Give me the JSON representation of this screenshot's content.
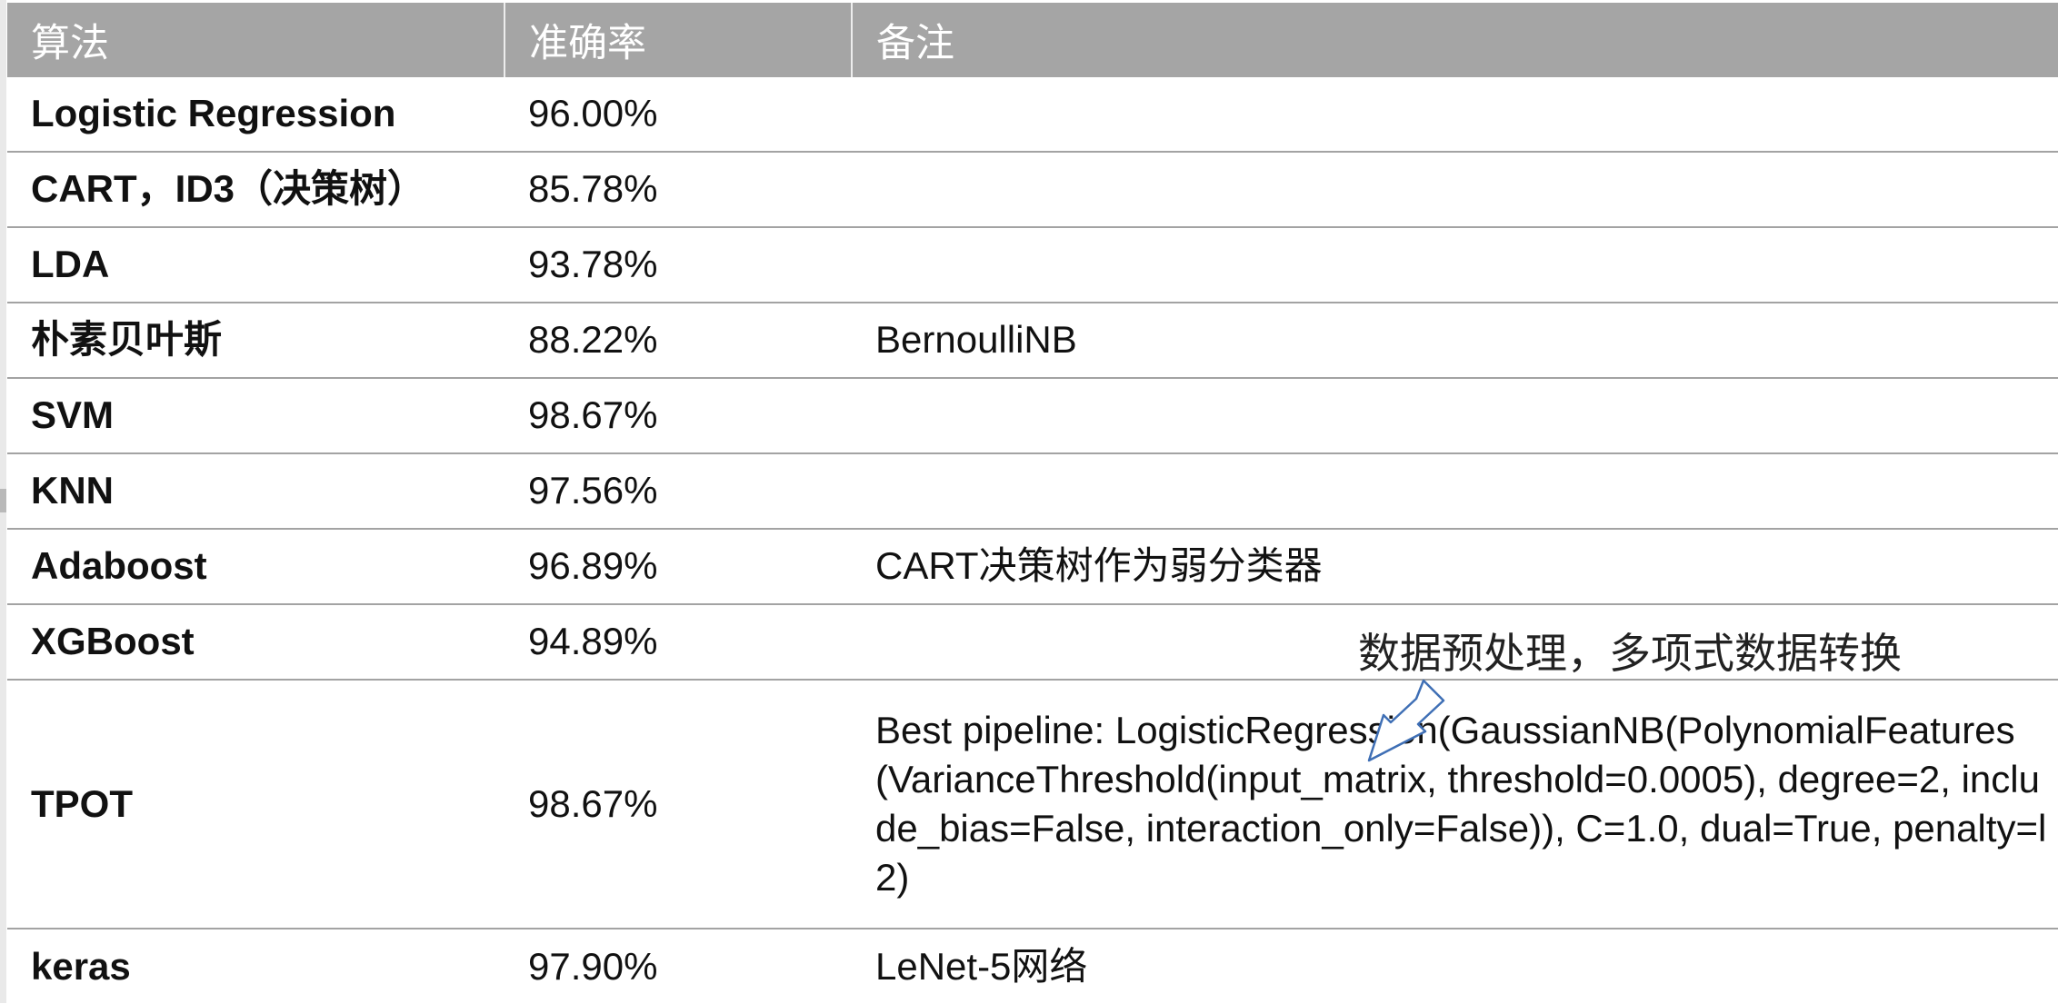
{
  "table": {
    "headers": [
      "算法",
      "准确率",
      "备注"
    ],
    "rows": [
      {
        "algorithm": "Logistic Regression",
        "accuracy": "96.00%",
        "note": ""
      },
      {
        "algorithm": "CART，ID3（决策树）",
        "accuracy": "85.78%",
        "note": ""
      },
      {
        "algorithm": "LDA",
        "accuracy": "93.78%",
        "note": ""
      },
      {
        "algorithm": "朴素贝叶斯",
        "accuracy": "88.22%",
        "note": "BernoulliNB"
      },
      {
        "algorithm": "SVM",
        "accuracy": "98.67%",
        "note": ""
      },
      {
        "algorithm": "KNN",
        "accuracy": "97.56%",
        "note": ""
      },
      {
        "algorithm": "Adaboost",
        "accuracy": "96.89%",
        "note": "CART决策树作为弱分类器"
      },
      {
        "algorithm": "XGBoost",
        "accuracy": "94.89%",
        "note": ""
      },
      {
        "algorithm": "TPOT",
        "accuracy": "98.67%",
        "note": "Best pipeline: LogisticRegression(GaussianNB(PolynomialFeatures(VarianceThreshold(input_matrix, threshold=0.0005), degree=2, include_bias=False, interaction_only=False)), C=1.0, dual=True, penalty=l2)"
      },
      {
        "algorithm": "keras",
        "accuracy": "97.90%",
        "note": "LeNet-5网络"
      }
    ]
  },
  "annotation": {
    "text": "数据预处理，多项式数据转换",
    "icon": "arrow-icon"
  },
  "colors": {
    "header_bg": "#a5a5a5",
    "header_text": "#ffffff",
    "row_border": "#a3a3a3",
    "arrow_stroke": "#3f6fb5"
  }
}
